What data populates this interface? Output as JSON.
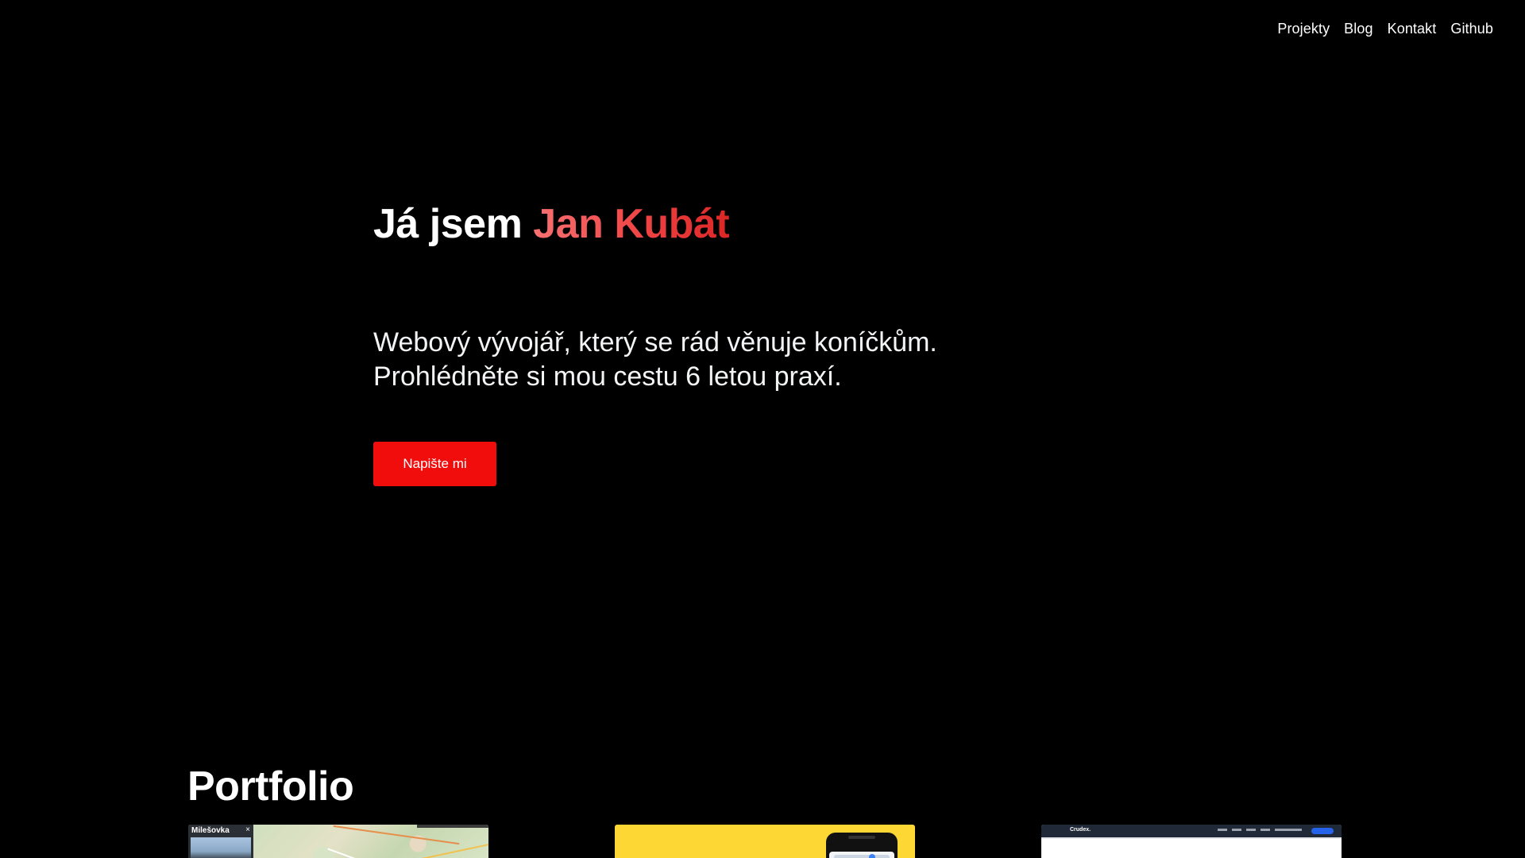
{
  "nav": {
    "items": [
      {
        "label": "Projekty"
      },
      {
        "label": "Blog"
      },
      {
        "label": "Kontakt"
      },
      {
        "label": "Github"
      }
    ]
  },
  "hero": {
    "title_prefix": "Já jsem",
    "title_name": "Jan Kubát",
    "subtitle_line1": "Webový vývojář, který se rád věnuje koníčkům.",
    "subtitle_line2": "Prohlédněte si mou cestu 6 letou praxí.",
    "cta_label": "Napište mi"
  },
  "portfolio": {
    "title": "Portfolio",
    "cards": [
      {
        "caption": "Milešovka",
        "close_glyph": "×"
      },
      {},
      {
        "brand": "Crudex."
      }
    ]
  },
  "colors": {
    "background": "#000000",
    "accent": "#f20d0d",
    "name_gradient_start": "#f87171",
    "name_gradient_end": "#dc2626",
    "card2_bg": "#fdd835"
  }
}
